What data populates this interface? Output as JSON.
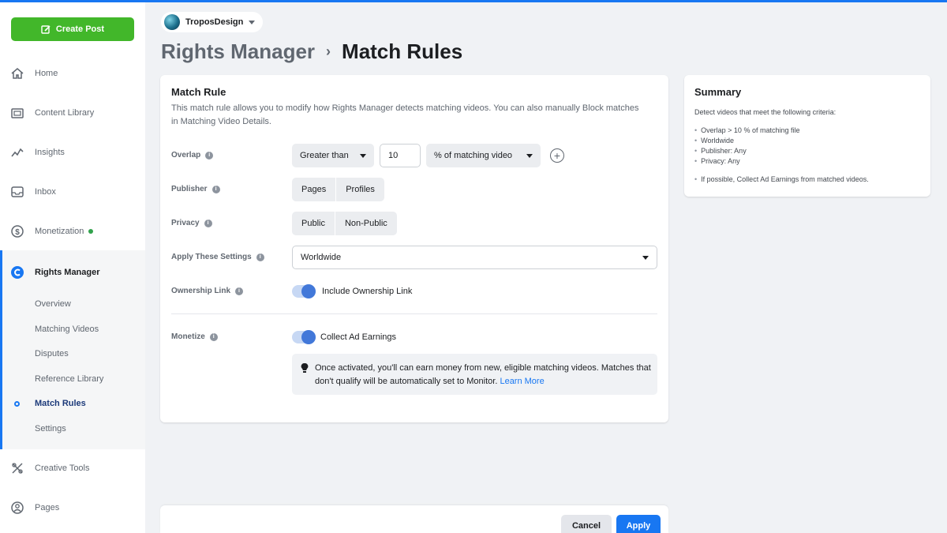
{
  "sidebar": {
    "create_post": "Create Post",
    "items": [
      {
        "label": "Home",
        "icon": "home-icon"
      },
      {
        "label": "Content Library",
        "icon": "content-library-icon"
      },
      {
        "label": "Insights",
        "icon": "insights-icon"
      },
      {
        "label": "Inbox",
        "icon": "inbox-icon"
      },
      {
        "label": "Monetization",
        "icon": "dollar-icon",
        "status_dot": true
      }
    ],
    "rights_manager": {
      "label": "Rights Manager",
      "icon": "rights-manager-icon",
      "subitems": [
        "Overview",
        "Matching Videos",
        "Disputes",
        "Reference Library",
        "Match Rules",
        "Settings"
      ],
      "active": "Match Rules"
    },
    "bottom_items": [
      {
        "label": "Creative Tools",
        "icon": "creative-tools-icon"
      },
      {
        "label": "Pages",
        "icon": "pages-icon"
      }
    ]
  },
  "header": {
    "page_name": "TroposDesign",
    "breadcrumb_parent": "Rights Manager",
    "breadcrumb_separator": "›",
    "breadcrumb_current": "Match Rules"
  },
  "match_rule": {
    "title": "Match Rule",
    "description": "This match rule allows you to modify how Rights Manager detects matching videos. You can also manually Block matches in Matching Video Details.",
    "overlap": {
      "label": "Overlap",
      "operator": "Greater than",
      "value": "10",
      "unit": "% of matching video"
    },
    "publisher": {
      "label": "Publisher",
      "options": [
        "Pages",
        "Profiles"
      ]
    },
    "privacy": {
      "label": "Privacy",
      "options": [
        "Public",
        "Non-Public"
      ]
    },
    "apply_settings": {
      "label": "Apply These Settings",
      "value": "Worldwide"
    },
    "ownership_link": {
      "label": "Ownership Link",
      "toggle_label": "Include Ownership Link",
      "enabled": true
    },
    "monetize": {
      "label": "Monetize",
      "toggle_label": "Collect Ad Earnings",
      "enabled": true
    },
    "notice": {
      "text": "Once activated, you'll can earn money from new, eligible matching videos. Matches that don't qualify will be automatically set to Monitor.",
      "link": "Learn More"
    }
  },
  "summary": {
    "title": "Summary",
    "intro": "Detect videos that meet the following criteria:",
    "criteria": [
      "Overlap > 10 % of matching file",
      "Worldwide",
      "Publisher: Any",
      "Privacy: Any"
    ],
    "extra": "If possible, Collect Ad Earnings from matched videos."
  },
  "footer": {
    "cancel": "Cancel",
    "apply": "Apply"
  },
  "colors": {
    "accent": "#1877f2",
    "create_button": "#42b72a",
    "toggle_knob": "#4278d9"
  }
}
